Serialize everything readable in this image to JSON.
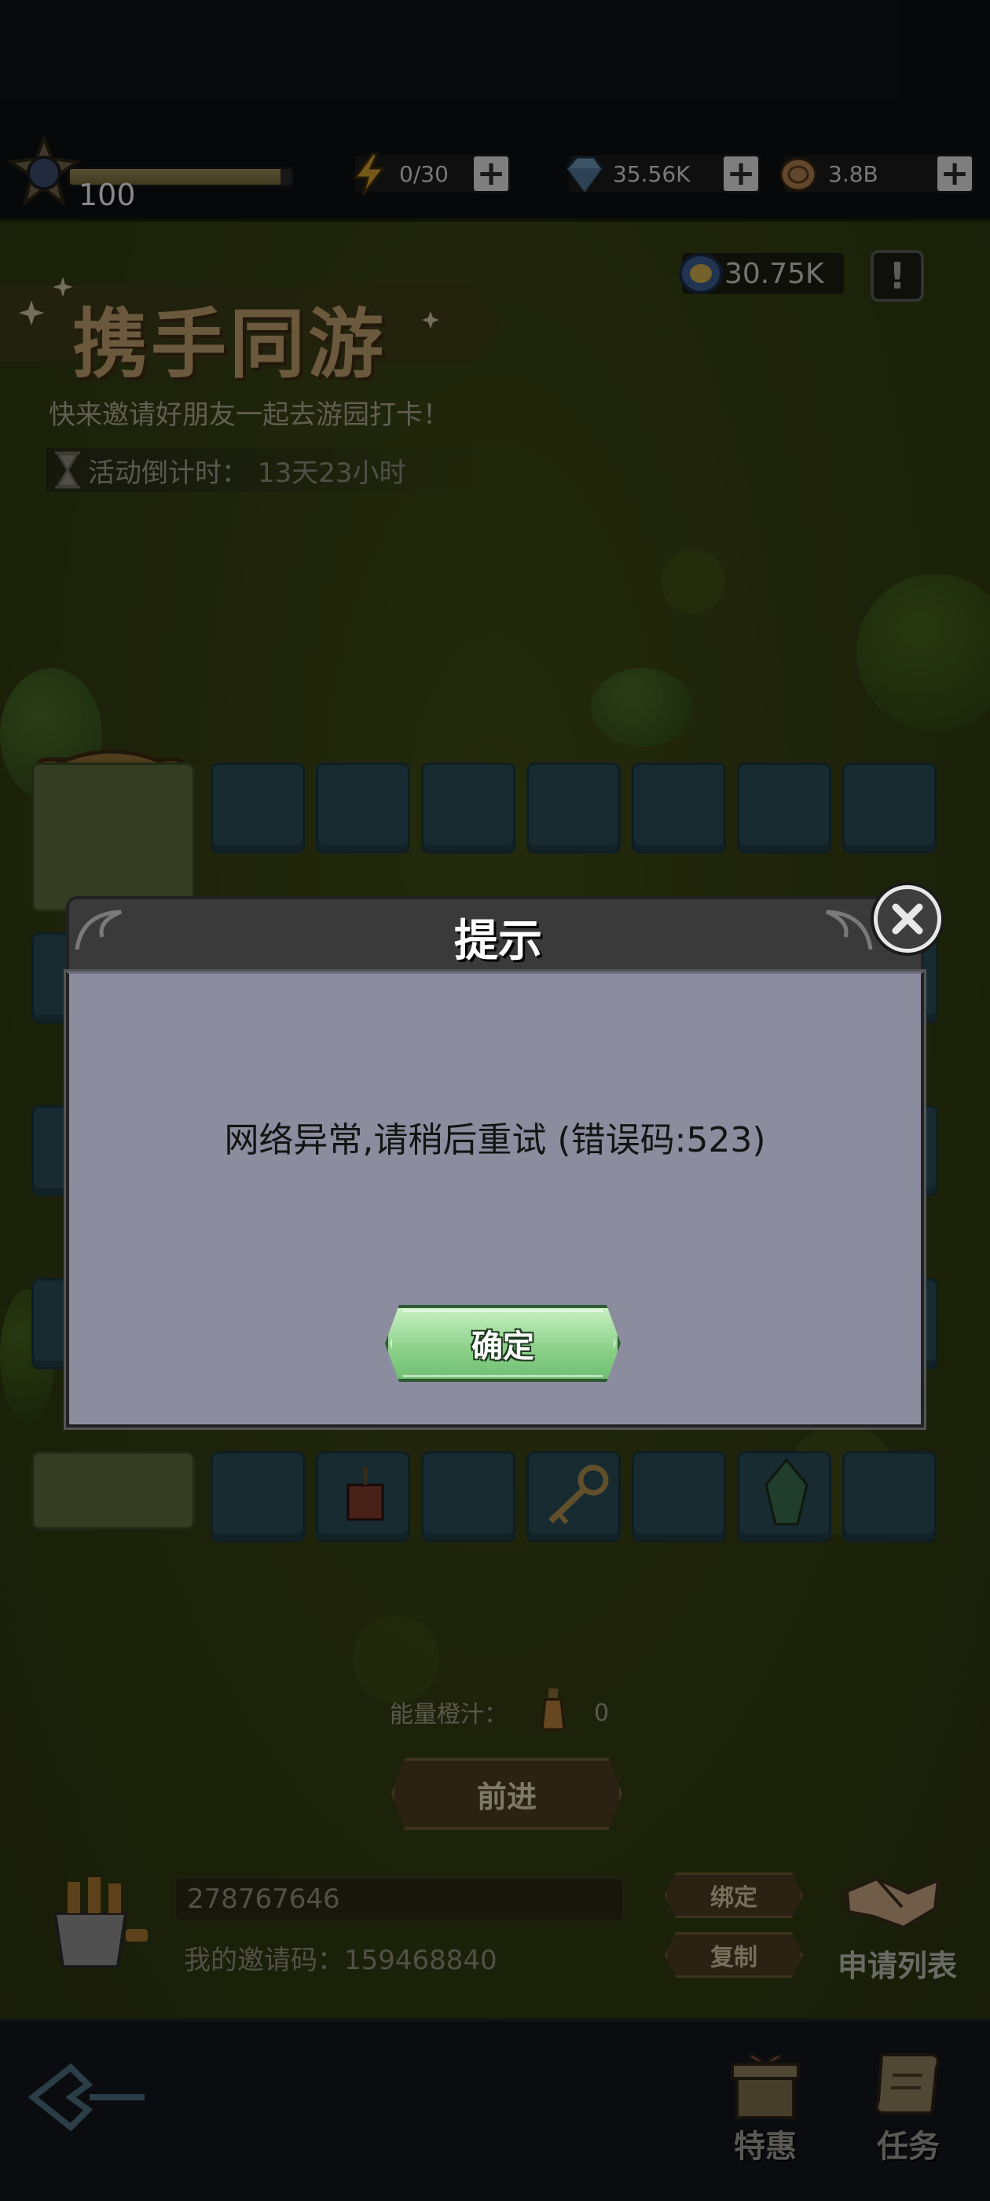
{
  "resources": {
    "level": "100",
    "level_progress": 0.95,
    "energy": "0/30",
    "gems": "35.56K",
    "coins": "3.8B"
  },
  "event": {
    "title": "携手同游",
    "subtitle": "快来邀请好朋友一起去游园打卡！",
    "countdown_label": "活动倒计时：",
    "countdown_value": "13天23小时",
    "token_count": "30.75K",
    "info_label": "!"
  },
  "board": {
    "energy_label": "能量橙汁：",
    "energy_value": "0",
    "forward_label": "前进"
  },
  "invite": {
    "input_value": "278767646",
    "my_code_label": "我的邀请码：",
    "my_code_value": "159468840",
    "bind_label": "绑定",
    "copy_label": "复制",
    "apply_list_label": "申请列表"
  },
  "nav": {
    "specials_label": "特惠",
    "tasks_label": "任务"
  },
  "dialog": {
    "title": "提示",
    "message": "网络异常,请稍后重试 (错误码:523)",
    "confirm_label": "确定"
  },
  "colors": {
    "dialog_body": "#8b8d9e",
    "confirm_green": "#8fd28c",
    "field_green": "#343d12"
  }
}
